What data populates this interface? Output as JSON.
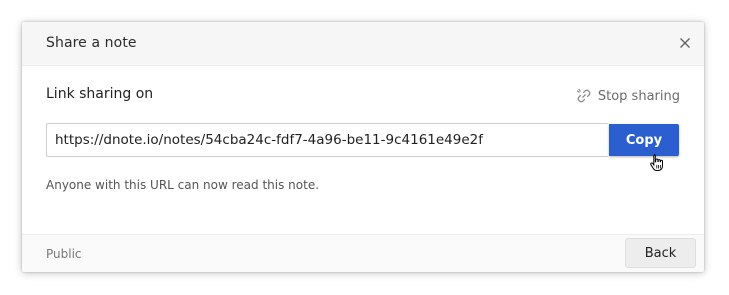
{
  "dialog": {
    "title": "Share a note",
    "close_icon": "close-icon"
  },
  "sharing": {
    "status": "Link sharing on",
    "stop_label": "Stop sharing",
    "stop_icon": "link-icon",
    "url": "https://dnote.io/notes/54cba24c-fdf7-4a96-be11-9c4161e49e2f",
    "copy_label": "Copy",
    "hint": "Anyone with this URL can now read this note."
  },
  "footer": {
    "visibility": "Public",
    "back_label": "Back"
  },
  "colors": {
    "accent": "#2b5fcf",
    "header_bg": "#f6f6f6"
  }
}
